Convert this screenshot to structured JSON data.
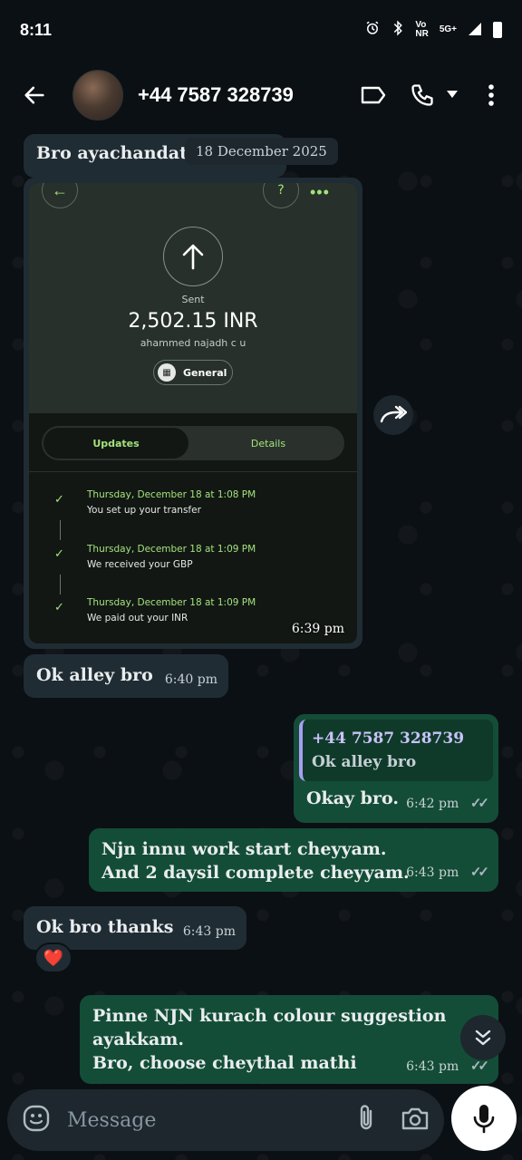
{
  "status_bar": {
    "time": "8:11",
    "network_top": "Vo",
    "network_mid": "NR",
    "network_type": "5G+",
    "icons": [
      "alarm-icon",
      "bluetooth-icon",
      "volte-icon",
      "signal-icon",
      "battery-icon"
    ]
  },
  "header": {
    "contact_name": "+44 7587 328739",
    "icons": [
      "back-arrow-icon",
      "label-icon",
      "phone-icon",
      "dropdown-icon",
      "more-vert-icon"
    ]
  },
  "chat": {
    "truncated_message": "Bro ayachandatt",
    "date_chip": "18 December 2025",
    "image_message": {
      "status": "Sent",
      "amount": "2,502.15 INR",
      "recipient": "ahammed najadh c u",
      "category": "General",
      "tabs": [
        "Updates",
        "Details"
      ],
      "timeline": [
        {
          "date": "Thursday, December 18 at 1:08 PM",
          "desc": "You set up your transfer"
        },
        {
          "date": "Thursday, December 18 at 1:09 PM",
          "desc": "We received your GBP"
        },
        {
          "date": "Thursday, December 18 at 1:09 PM",
          "desc": "We paid out your INR"
        }
      ],
      "time": "6:39 pm"
    },
    "messages": [
      {
        "text": "Ok alley bro",
        "time": "6:40 pm",
        "direction": "in"
      },
      {
        "reply_to_name": "+44 7587 328739",
        "reply_to_text": "Ok alley bro",
        "text": "Okay bro.",
        "time": "6:42 pm",
        "direction": "out"
      },
      {
        "line1": "Njn innu work start  cheyyam.",
        "line2": "And 2 daysil complete cheyyam.",
        "time": "6:43 pm",
        "direction": "out"
      },
      {
        "text": "Ok bro thanks",
        "time": "6:43 pm",
        "direction": "in",
        "reaction": "❤️"
      },
      {
        "line1": "Pinne NJN kurach colour suggestion",
        "line2": "ayakkam.",
        "line3": "Bro, choose cheythal mathi",
        "time": "6:43 pm",
        "direction": "out"
      }
    ],
    "read_ticks": "✓✓"
  },
  "input": {
    "placeholder": "Message"
  },
  "colors": {
    "background": "#0b1014",
    "incoming_bubble": "#202c33",
    "outgoing_bubble": "#144d37",
    "accent_green": "#a3e27a",
    "reply_bar": "#a79ff0"
  }
}
